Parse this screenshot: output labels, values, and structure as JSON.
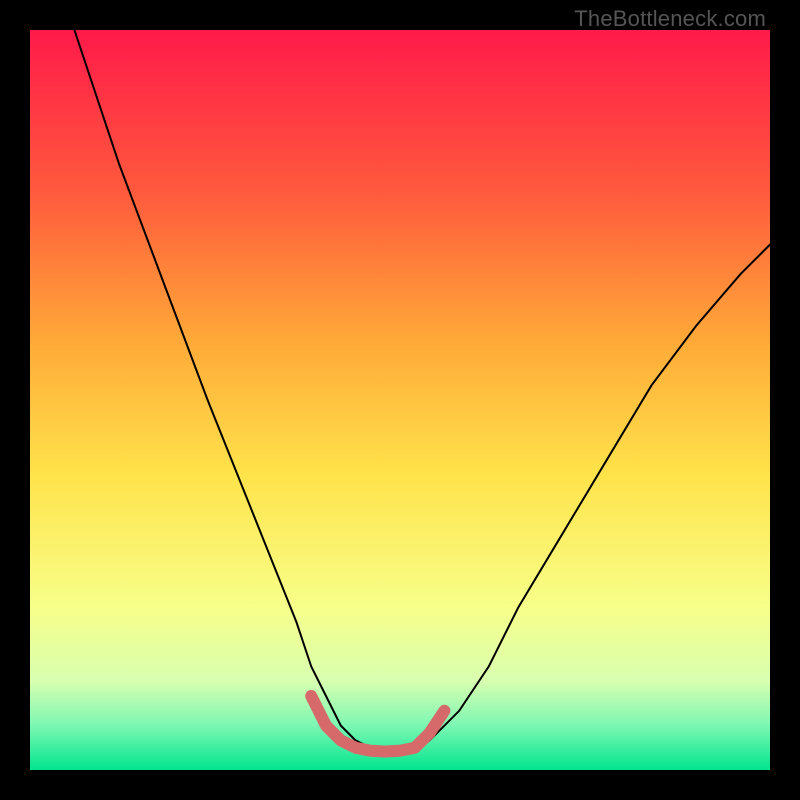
{
  "watermark": "TheBottleneck.com",
  "colors": {
    "frame": "#000000",
    "grad_top": "#ff1a4a",
    "grad_mid1": "#ff7a2b",
    "grad_mid2": "#ffe34a",
    "grad_mid3": "#f7ff8a",
    "grad_low1": "#d8ffb0",
    "grad_low2": "#7cf7b3",
    "grad_bottom": "#00e58d",
    "curve": "#000000",
    "marker": "#d66a6a"
  },
  "chart_data": {
    "type": "line",
    "title": "",
    "xlabel": "",
    "ylabel": "",
    "xlim": [
      0,
      100
    ],
    "ylim": [
      0,
      100
    ],
    "grid": false,
    "legend": false,
    "series": [
      {
        "name": "bottleneck-curve",
        "x": [
          0,
          6,
          12,
          18,
          24,
          28,
          32,
          36,
          38,
          40,
          42,
          44,
          46,
          48,
          50,
          52,
          54,
          58,
          62,
          66,
          72,
          78,
          84,
          90,
          96,
          100
        ],
        "y": [
          120,
          100,
          82,
          66,
          50,
          40,
          30,
          20,
          14,
          10,
          6,
          4,
          3,
          2.5,
          2.4,
          2.5,
          4,
          8,
          14,
          22,
          32,
          42,
          52,
          60,
          67,
          71
        ]
      }
    ],
    "markers": [
      {
        "name": "optimal-range",
        "x": [
          38,
          40,
          42,
          44,
          46,
          48,
          50,
          52,
          54,
          56
        ],
        "y": [
          10,
          6,
          4,
          3,
          2.6,
          2.5,
          2.6,
          3,
          5,
          8
        ]
      }
    ],
    "gradient_stops": [
      {
        "offset": 0.0,
        "color": "#ff1a4a"
      },
      {
        "offset": 0.22,
        "color": "#ff5a3d"
      },
      {
        "offset": 0.42,
        "color": "#ffa938"
      },
      {
        "offset": 0.6,
        "color": "#ffe34a"
      },
      {
        "offset": 0.78,
        "color": "#f7ff8a"
      },
      {
        "offset": 0.88,
        "color": "#d8ffb0"
      },
      {
        "offset": 0.94,
        "color": "#7cf7b3"
      },
      {
        "offset": 1.0,
        "color": "#00e58d"
      }
    ]
  }
}
